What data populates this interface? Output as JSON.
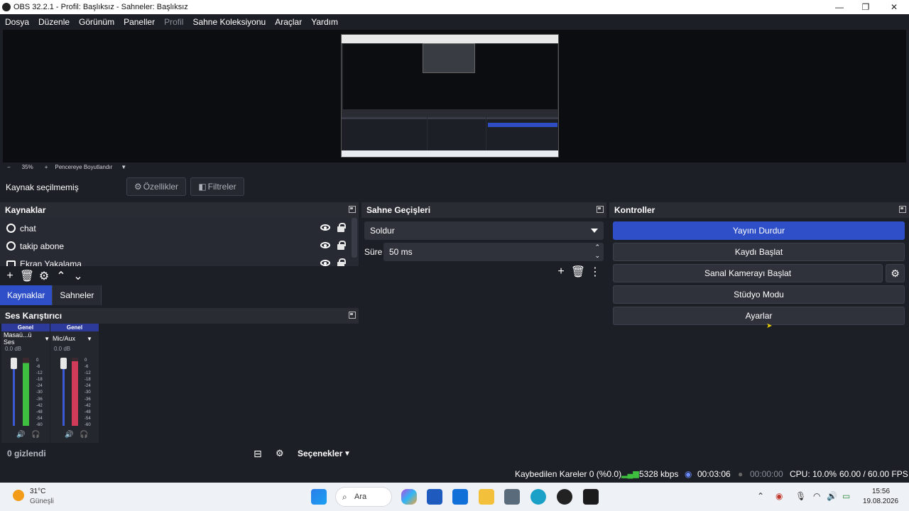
{
  "window": {
    "title": "OBS 32.2.1 - Profil: Başlıksız - Sahneler: Başlıksız",
    "minimize": "—",
    "maximize": "❐",
    "close": "✕"
  },
  "menu": [
    "Dosya",
    "Düzenle",
    "Görünüm",
    "Paneller",
    "Profil",
    "Sahne Koleksiyonu",
    "Araçlar",
    "Yardım"
  ],
  "preview": {
    "zoom_out": "−",
    "zoom_level": "35%",
    "zoom_in": "+",
    "fit_label": "Pencereye Boyutlandır"
  },
  "sourcebar": {
    "no_selection": "Kaynak seçilmemiş",
    "properties": "Özellikler",
    "filters": "Filtreler"
  },
  "sources": {
    "title": "Kaynaklar",
    "items": [
      {
        "name": "chat",
        "icon": "globe-icon"
      },
      {
        "name": "takip abone",
        "icon": "globe-icon"
      },
      {
        "name": "Ekran Yakalama",
        "icon": "monitor-icon"
      }
    ]
  },
  "dock_tabs": [
    "Kaynaklar",
    "Sahneler"
  ],
  "mixer": {
    "title": "Ses Karıştırıcı",
    "scale": [
      "0",
      "-6",
      "-12",
      "-18",
      "-24",
      "-30",
      "-36",
      "-42",
      "-48",
      "-54",
      "-60"
    ],
    "channels": [
      {
        "group": "Genel",
        "name": "Masaü...ü Ses",
        "db": "0.0 dB",
        "level": 0.92
      },
      {
        "group": "Genel",
        "name": "Mic/Aux",
        "db": "0.0 dB",
        "level": 0.95
      }
    ],
    "hidden_count": "0 gizlendi",
    "options": "Seçenekler"
  },
  "transitions": {
    "title": "Sahne Geçişleri",
    "selected": "Soldur",
    "duration_label": "Süre",
    "duration_value": "50 ms"
  },
  "controls": {
    "title": "Kontroller",
    "stop_stream": "Yayını Durdur",
    "start_record": "Kaydı Başlat",
    "start_virtualcam": "Sanal Kamerayı Başlat",
    "studio_mode": "Stüdyo Modu",
    "settings": "Ayarlar"
  },
  "status": {
    "dropped_frames": "Kaybedilen Kareler 0 (%0.0)",
    "bitrate": "5328 kbps",
    "stream_time": "00:03:06",
    "record_time": "00:00:00",
    "cpu": "CPU: 10.0%",
    "fps": "60.00 / 60.00 FPS"
  },
  "taskbar": {
    "weather_temp": "31°C",
    "weather_desc": "Güneşli",
    "search": "Ara",
    "time": "15:56",
    "date": "19.08.2026"
  },
  "colors": {
    "accent": "#2e4fc7",
    "background": "#1d1f26",
    "dock_header": "#2a2c34",
    "meter_green": "#3fbf3f",
    "meter_red": "#d23a5a"
  }
}
